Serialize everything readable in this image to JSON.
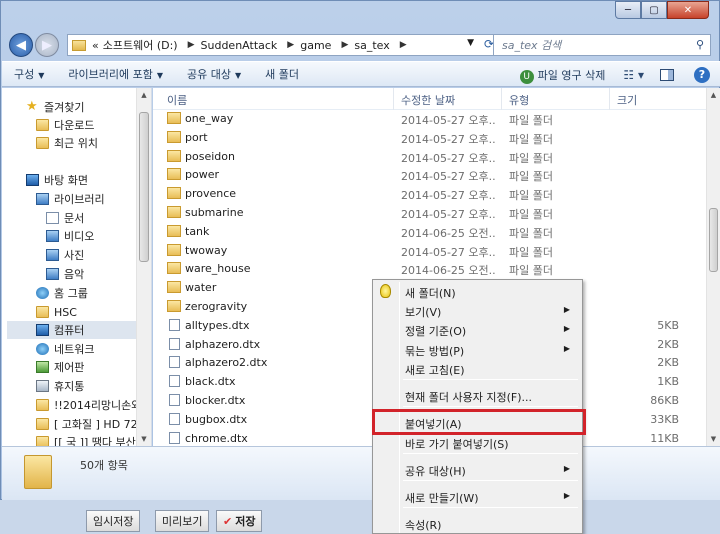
{
  "window": {
    "title_buttons": {
      "minimize": "─",
      "maximize": "▢",
      "close": "✕"
    }
  },
  "nav": {
    "back_icon": "back-arrow",
    "forward_icon": "forward-arrow"
  },
  "address": {
    "prefix": "«",
    "crumbs": [
      "소프트웨어 (D:)",
      "SuddenAttack",
      "game",
      "sa_tex"
    ]
  },
  "search": {
    "placeholder": "sa_tex 검색"
  },
  "toolbar": {
    "organize": "구성",
    "include_library": "라이브러리에 포함",
    "share": "공유 대상",
    "new_folder": "새 폴더",
    "perm_delete": "파일 영구 삭제"
  },
  "sidebar": {
    "items": [
      {
        "label": "즐겨찾기",
        "icon": "star"
      },
      {
        "label": "다운로드",
        "icon": "folder"
      },
      {
        "label": "최근 위치",
        "icon": "folder"
      },
      {
        "label": "바탕 화면",
        "icon": "pc"
      },
      {
        "label": "라이브러리",
        "icon": "lib"
      },
      {
        "label": "문서",
        "icon": "doc"
      },
      {
        "label": "비디오",
        "icon": "lib"
      },
      {
        "label": "사진",
        "icon": "lib"
      },
      {
        "label": "음악",
        "icon": "lib"
      },
      {
        "label": "홈 그룹",
        "icon": "net"
      },
      {
        "label": "HSC",
        "icon": "folder"
      },
      {
        "label": "컴퓨터",
        "icon": "pc"
      },
      {
        "label": "네트워크",
        "icon": "net"
      },
      {
        "label": "제어판",
        "icon": "green"
      },
      {
        "label": "휴지통",
        "icon": "bin"
      },
      {
        "label": "!!2014리망니손와",
        "icon": "folder"
      },
      {
        "label": "[ 고화질 ] HD 72",
        "icon": "folder"
      },
      {
        "label": "[[ 국 ]] 땡다 부산",
        "icon": "folder"
      }
    ]
  },
  "columns": {
    "name": "이름",
    "date": "수정한 날짜",
    "type": "유형",
    "size": "크기"
  },
  "files": [
    {
      "name": "one_way",
      "date": "2014-05-27 오후...",
      "type": "파일 폴더",
      "size": "",
      "kind": "folder"
    },
    {
      "name": "port",
      "date": "2014-05-27 오후...",
      "type": "파일 폴더",
      "size": "",
      "kind": "folder"
    },
    {
      "name": "poseidon",
      "date": "2014-05-27 오후...",
      "type": "파일 폴더",
      "size": "",
      "kind": "folder"
    },
    {
      "name": "power",
      "date": "2014-05-27 오후...",
      "type": "파일 폴더",
      "size": "",
      "kind": "folder"
    },
    {
      "name": "provence",
      "date": "2014-05-27 오후...",
      "type": "파일 폴더",
      "size": "",
      "kind": "folder"
    },
    {
      "name": "submarine",
      "date": "2014-05-27 오후...",
      "type": "파일 폴더",
      "size": "",
      "kind": "folder"
    },
    {
      "name": "tank",
      "date": "2014-06-25 오전...",
      "type": "파일 폴더",
      "size": "",
      "kind": "folder"
    },
    {
      "name": "twoway",
      "date": "2014-05-27 오후...",
      "type": "파일 폴더",
      "size": "",
      "kind": "folder"
    },
    {
      "name": "ware_house",
      "date": "2014-06-25 오전...",
      "type": "파일 폴더",
      "size": "",
      "kind": "folder"
    },
    {
      "name": "water",
      "date": "",
      "type": "",
      "size": "",
      "kind": "folder"
    },
    {
      "name": "zerogravity",
      "date": "",
      "type": "",
      "size": "",
      "kind": "folder"
    },
    {
      "name": "alltypes.dtx",
      "date": "",
      "type": "",
      "size": "5KB",
      "kind": "file"
    },
    {
      "name": "alphazero.dtx",
      "date": "",
      "type": "",
      "size": "2KB",
      "kind": "file"
    },
    {
      "name": "alphazero2.dtx",
      "date": "",
      "type": "",
      "size": "2KB",
      "kind": "file"
    },
    {
      "name": "black.dtx",
      "date": "",
      "type": "",
      "size": "1KB",
      "kind": "file"
    },
    {
      "name": "blocker.dtx",
      "date": "",
      "type": "",
      "size": "86KB",
      "kind": "file"
    },
    {
      "name": "bugbox.dtx",
      "date": "",
      "type": "",
      "size": "33KB",
      "kind": "file"
    },
    {
      "name": "chrome.dtx",
      "date": "",
      "type": "",
      "size": "11KB",
      "kind": "file"
    }
  ],
  "details": {
    "count": "50개 항목"
  },
  "bottom": {
    "temp_save": "임시저장",
    "preview": "미리보기",
    "save": "저장"
  },
  "context_menu": {
    "items": [
      {
        "label": "새 폴더(N)",
        "submenu": false
      },
      {
        "label": "보기(V)",
        "submenu": true
      },
      {
        "label": "정렬 기준(O)",
        "submenu": true
      },
      {
        "label": "묶는 방법(P)",
        "submenu": true
      },
      {
        "label": "새로 고침(E)",
        "submenu": false
      },
      {
        "label": "현재 폴더 사용자 지정(F)...",
        "submenu": false
      },
      {
        "label": "붙여넣기(A)",
        "submenu": false
      },
      {
        "label": "바로 가기 붙여넣기(S)",
        "submenu": false
      },
      {
        "label": "공유 대상(H)",
        "submenu": true
      },
      {
        "label": "새로 만들기(W)",
        "submenu": true
      },
      {
        "label": "속성(R)",
        "submenu": false
      }
    ]
  },
  "colors": {
    "highlight_box": "#d2232a"
  }
}
